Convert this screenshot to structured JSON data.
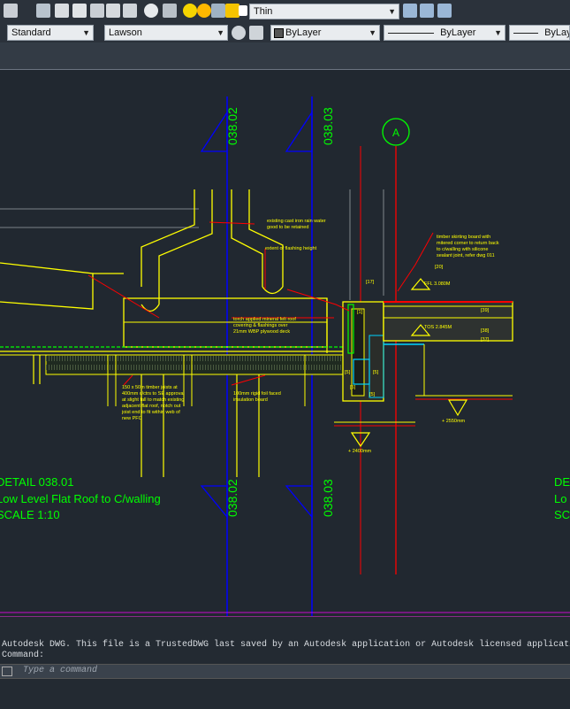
{
  "toolbar": {
    "linetype_value": "Thin",
    "text_style": "Standard",
    "dim_style": "Lawson",
    "layer_color": "ByLayer",
    "linetype": "ByLayer",
    "lineweight": "ByLayer"
  },
  "drawing": {
    "grid_a_label": "A",
    "section_1": "038.02",
    "section_2": "038.03",
    "detail_title": "DETAIL 038.01",
    "detail_name": "Low Level Flat Roof to C/walling",
    "detail_scale": "SCALE 1:10",
    "right_title": "DE",
    "right_name": "Lo",
    "right_scale": "SC",
    "notes": {
      "rain_water_1": "existing cast iron rain water",
      "rain_water_2": "good to be retained",
      "flashing": "extent of flashing height",
      "skirting_1": "timber skirting board with",
      "skirting_2": "mitered corner to return back",
      "skirting_3": "to c/walling with silicone",
      "skirting_4": "sealant joint, refer dwg 011",
      "felt_1": "torch applied mineral felt roof",
      "felt_2": "covering & flashings over",
      "felt_3": "21mm WBP plywood deck",
      "joist_1": "150 x 50m timber joists at",
      "joist_2": "400mm c/ctrs to SE approval",
      "joist_3": "at slight fall to match existing",
      "joist_4": "adjacent flat roof, notch out",
      "joist_5": "joist end to fit within web of",
      "joist_6": "new PFC",
      "insulation_1": "100mm rigid foil faced",
      "insulation_2": "insulation board",
      "ffl": "FFL 3.080M",
      "tos": "TOS 2.845M",
      "level_low": "+ 2400mm",
      "level_right": "+ 2550mm",
      "tag_17": "[17]",
      "tag_20": "[20]",
      "tag_39": "[39]",
      "tag_38": "[38]",
      "tag_37": "[37]",
      "tag_1": "[1]",
      "tag_5a": "[5]",
      "tag_5b": "[5]",
      "tag_5c": "[5]",
      "tag_5d": "[5]"
    }
  },
  "command": {
    "history_1": "Autodesk DWG.  This file is a TrustedDWG last saved by an Autodesk application or Autodesk licensed application.",
    "history_2": "Command:",
    "placeholder": "Type a command"
  },
  "colors": {
    "canvas": "#212830",
    "yellow": "#ffff00",
    "red": "#ff0000",
    "green": "#00ff00",
    "blue": "#0000ff",
    "white": "#ffffff"
  }
}
